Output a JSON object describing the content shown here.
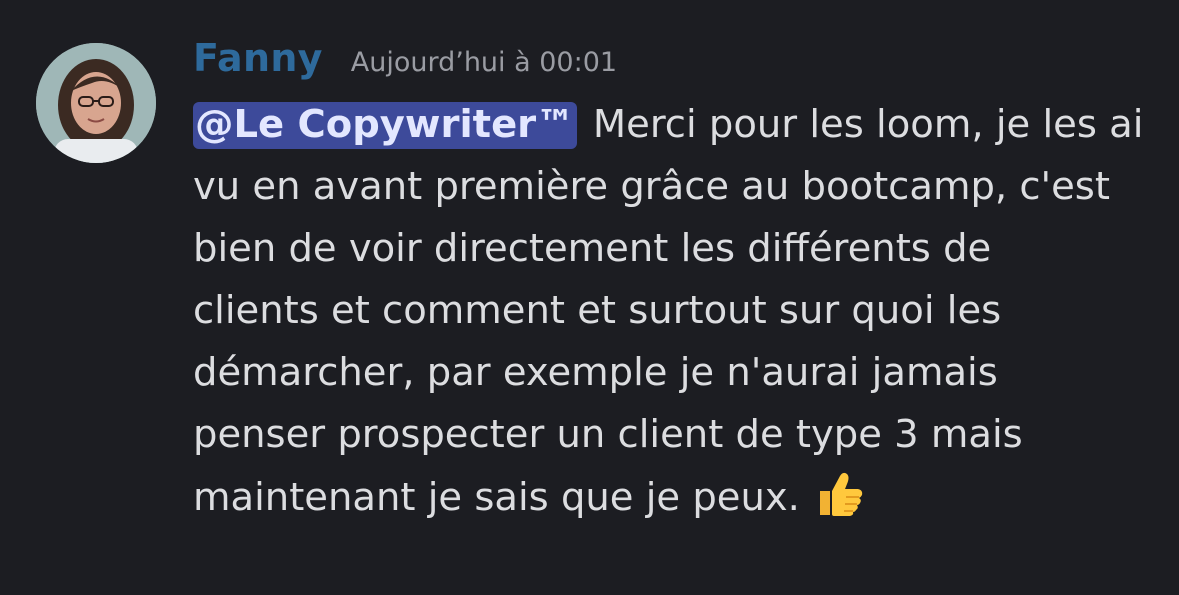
{
  "message": {
    "author": "Fanny",
    "timestamp": "Aujourd’hui à 00:01",
    "mention": "@Le Copywriter™",
    "lines": [
      " Merci pour les loom, je les ai",
      "vu en avant première grâce au bootcamp, c'est",
      "bien de voir directement les différents de",
      "clients et comment et surtout sur quoi les",
      "démarcher, par exemple je n'aurai jamais",
      "penser prospecter un client de type 3 mais",
      "maintenant je sais que je peux."
    ],
    "emoji": "thumbs-up-icon"
  },
  "colors": {
    "background": "#1c1d22",
    "author": "#2e6a9c",
    "timestamp": "#9a9ca3",
    "text": "#dcdde0",
    "mention_bg": "#3d4a9a",
    "mention_text": "#e3e7ff"
  }
}
